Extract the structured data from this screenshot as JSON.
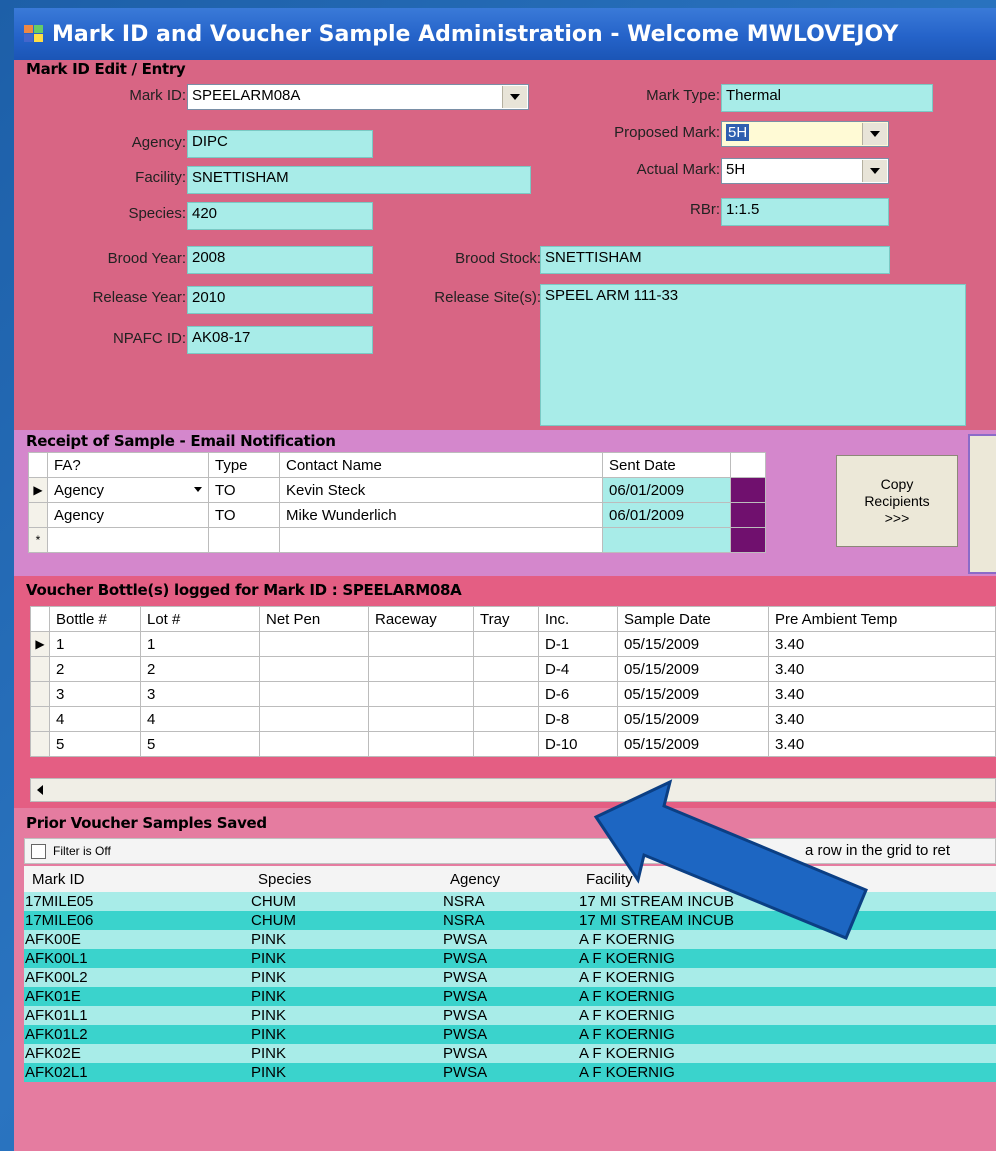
{
  "window": {
    "title": "Mark ID and Voucher Sample Administration - Welcome MWLOVEJOY"
  },
  "mark_edit": {
    "section_title": "Mark ID Edit / Entry",
    "mark_id_label": "Mark ID:",
    "mark_id": "SPEELARM08A",
    "agency_label": "Agency:",
    "agency": "DIPC",
    "facility_label": "Facility:",
    "facility": "SNETTISHAM",
    "species_label": "Species:",
    "species": "420",
    "brood_year_label": "Brood Year:",
    "brood_year": "2008",
    "release_year_label": "Release Year:",
    "release_year": "2010",
    "npafc_label": "NPAFC ID:",
    "npafc": "AK08-17",
    "mark_type_label": "Mark Type:",
    "mark_type": "Thermal",
    "proposed_mark_label": "Proposed Mark:",
    "proposed_mark": "5H",
    "actual_mark_label": "Actual Mark:",
    "actual_mark": "5H",
    "rbr_label": "RBr:",
    "rbr": "1:1.5",
    "brood_stock_label": "Brood Stock:",
    "brood_stock": "SNETTISHAM",
    "release_site_label": "Release Site(s):",
    "release_site": "SPEEL ARM 111-33"
  },
  "receipt": {
    "section_title": "Receipt of Sample - Email Notification",
    "headers": [
      "FA?",
      "Type",
      "Contact Name",
      "Sent Date"
    ],
    "rows": [
      {
        "fa": "Agency",
        "type": "TO",
        "name": "Kevin Steck",
        "date": "06/01/2009"
      },
      {
        "fa": "Agency",
        "type": "TO",
        "name": "Mike Wunderlich",
        "date": "06/01/2009"
      }
    ],
    "new_row_marker": "*",
    "copy_button": "Copy Recipients >>>",
    "copy_line1": "Copy",
    "copy_line2": "Recipients",
    "copy_line3": ">>>"
  },
  "voucher": {
    "section_title": "Voucher Bottle(s) logged for Mark ID : SPEELARM08A",
    "headers": [
      "Bottle #",
      "Lot #",
      "Net Pen",
      "Raceway",
      "Tray",
      "Inc.",
      "Sample Date",
      "Pre Ambient Temp"
    ],
    "rows": [
      {
        "bottle": "1",
        "lot": "1",
        "inc": "D-1",
        "date": "05/15/2009",
        "temp": "3.40"
      },
      {
        "bottle": "2",
        "lot": "2",
        "inc": "D-4",
        "date": "05/15/2009",
        "temp": "3.40"
      },
      {
        "bottle": "3",
        "lot": "3",
        "inc": "D-6",
        "date": "05/15/2009",
        "temp": "3.40"
      },
      {
        "bottle": "4",
        "lot": "4",
        "inc": "D-8",
        "date": "05/15/2009",
        "temp": "3.40"
      },
      {
        "bottle": "5",
        "lot": "5",
        "inc": "D-10",
        "date": "05/15/2009",
        "temp": "3.40"
      }
    ]
  },
  "prior": {
    "section_title": "Prior Voucher Samples Saved",
    "filter_label": "Filter is Off",
    "hint": "a row in the grid to ret",
    "headers": [
      "Mark ID",
      "Species",
      "Agency",
      "Facility"
    ],
    "rows": [
      {
        "id": "17MILE05",
        "species": "CHUM",
        "agency": "NSRA",
        "facility": "17 MI STREAM INCUB"
      },
      {
        "id": "17MILE06",
        "species": "CHUM",
        "agency": "NSRA",
        "facility": "17 MI STREAM INCUB"
      },
      {
        "id": "AFK00E",
        "species": "PINK",
        "agency": "PWSA",
        "facility": "A F KOERNIG"
      },
      {
        "id": "AFK00L1",
        "species": "PINK",
        "agency": "PWSA",
        "facility": "A F KOERNIG"
      },
      {
        "id": "AFK00L2",
        "species": "PINK",
        "agency": "PWSA",
        "facility": "A F KOERNIG"
      },
      {
        "id": "AFK01E",
        "species": "PINK",
        "agency": "PWSA",
        "facility": "A F KOERNIG"
      },
      {
        "id": "AFK01L1",
        "species": "PINK",
        "agency": "PWSA",
        "facility": "A F KOERNIG"
      },
      {
        "id": "AFK01L2",
        "species": "PINK",
        "agency": "PWSA",
        "facility": "A F KOERNIG"
      },
      {
        "id": "AFK02E",
        "species": "PINK",
        "agency": "PWSA",
        "facility": "A F KOERNIG"
      },
      {
        "id": "AFK02L1",
        "species": "PINK",
        "agency": "PWSA",
        "facility": "A F KOERNIG"
      }
    ]
  },
  "colors": {
    "mark_section": "#d86584",
    "receipt_section": "#d487cc",
    "voucher_section": "#e45e83",
    "prior_section": "#e57ca0",
    "arrow": "#1d66c2"
  }
}
